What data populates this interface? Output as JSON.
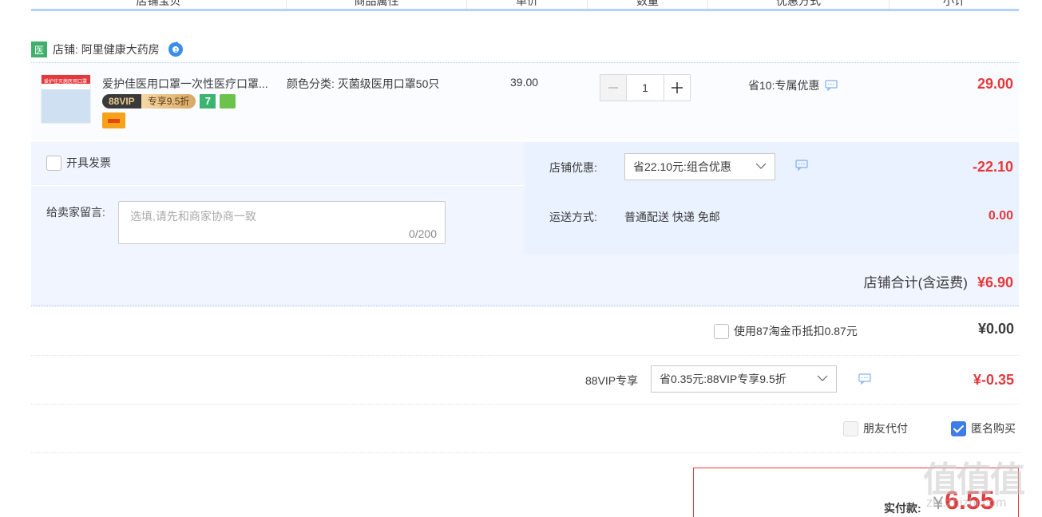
{
  "table_header": {
    "columns": [
      "店铺宝贝",
      "商品属性",
      "单价",
      "数量",
      "优惠方式",
      "小计"
    ]
  },
  "shop": {
    "badge": "医",
    "label": "店铺: 阿里健康大药房"
  },
  "item": {
    "image_text": "爱护佳灭菌医用口罩",
    "title": "爱护佳医用口罩一次性医疗口罩...",
    "vip_tag": "88VIP",
    "vip_discount_tag": "专享9.5折",
    "seven_day_tag": "7",
    "sku": "颜色分类: 灭菌级医用口罩50只",
    "unit_price": "39.00",
    "quantity": "1",
    "discount": "省10:专属优惠",
    "subtotal": "29.00"
  },
  "invoice_label": "开具发票",
  "note": {
    "label": "给卖家留言:",
    "placeholder": "选填,请先和商家协商一致",
    "counter": "0/200"
  },
  "shop_promo": {
    "label": "店铺优惠:",
    "selected": "省22.10元:组合优惠",
    "amount": "-22.10"
  },
  "shipping": {
    "label": "运送方式:",
    "value": "普通配送 快递 免邮",
    "amount": "0.00"
  },
  "shop_total": {
    "label": "店铺合计(含运费)",
    "value": "¥6.90"
  },
  "coin": {
    "label": "使用87淘金币抵扣0.87元",
    "amount": "¥0.00"
  },
  "vip": {
    "label": "88VIP专享",
    "selected": "省0.35元:88VIP专享9.5折",
    "amount": "¥-0.35"
  },
  "options": {
    "friend_pay": "朋友代付",
    "anonymous": "匿名购买"
  },
  "payment": {
    "label": "实付款:",
    "currency": "¥",
    "amount": "6.55"
  },
  "watermark": {
    "main": "值值值",
    "sub": "zhi.zhizhi.com"
  },
  "colors": {
    "accent_red": "#e4393c",
    "light_blue": "#f0f5ff",
    "header_line": "#b2d1ff",
    "checkbox_blue": "#3e7ce8"
  }
}
